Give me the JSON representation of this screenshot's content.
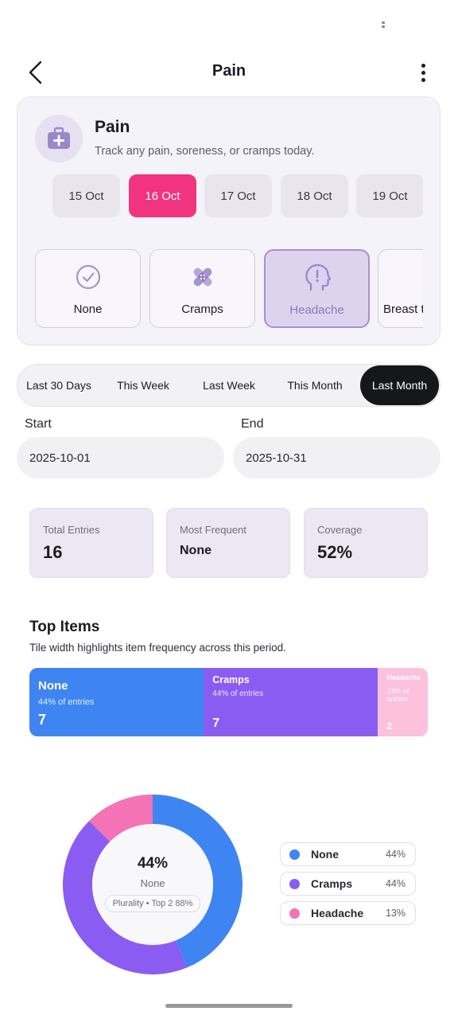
{
  "header": {
    "title": "Pain"
  },
  "card": {
    "title": "Pain",
    "subtitle": "Track any pain, soreness, or cramps today.",
    "dates": [
      {
        "label": "15 Oct",
        "active": false
      },
      {
        "label": "16 Oct",
        "active": true
      },
      {
        "label": "17 Oct",
        "active": false
      },
      {
        "label": "18 Oct",
        "active": false
      },
      {
        "label": "19 Oct",
        "active": false
      }
    ],
    "symptoms": [
      {
        "label": "None",
        "icon": "check-circle-icon",
        "selected": false
      },
      {
        "label": "Cramps",
        "icon": "bandage-icon",
        "selected": false
      },
      {
        "label": "Headache",
        "icon": "head-alert-icon",
        "selected": true
      },
      {
        "label": "Breast t",
        "icon": "",
        "selected": false
      }
    ]
  },
  "range_tabs": [
    {
      "label": "Last 30 Days",
      "active": false
    },
    {
      "label": "This Week",
      "active": false
    },
    {
      "label": "Last Week",
      "active": false
    },
    {
      "label": "This Month",
      "active": false
    },
    {
      "label": "Last Month",
      "active": true
    }
  ],
  "range": {
    "start_label": "Start",
    "start_value": "2025-10-01",
    "end_label": "End",
    "end_value": "2025-10-31"
  },
  "stats": [
    {
      "label": "Total Entries",
      "value": "16"
    },
    {
      "label": "Most Frequent",
      "value": "None"
    },
    {
      "label": "Coverage",
      "value": "52%"
    }
  ],
  "top_items": {
    "title": "Top Items",
    "subtitle": "Tile width highlights item frequency across this period."
  },
  "chart_data": {
    "type": "pie",
    "categories": [
      "None",
      "Cramps",
      "Headache"
    ],
    "counts": [
      7,
      7,
      2
    ],
    "tile_percent_labels": [
      "44% of entries",
      "44% of entries",
      "13% of entries"
    ],
    "legend_values": [
      "44%",
      "44%",
      "13%"
    ],
    "colors": [
      "#3f85f2",
      "#8b5cf2",
      "#f472b6"
    ],
    "tile_colors": [
      "#3f85f2",
      "#8b5cf2",
      "#fbc1dd"
    ],
    "center_value": "44%",
    "center_label": "None",
    "center_pill": "Plurality • Top 2 88%"
  }
}
